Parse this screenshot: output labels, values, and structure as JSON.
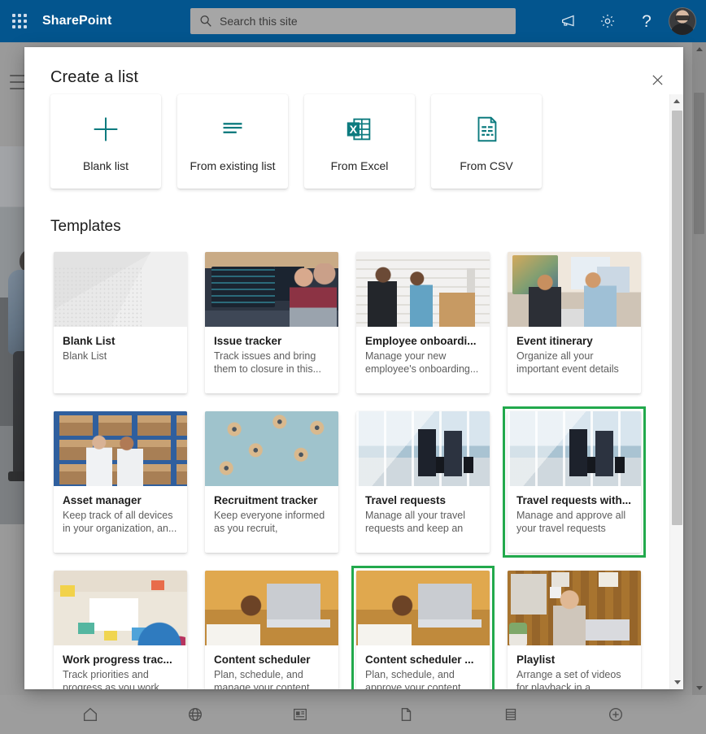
{
  "suite": {
    "waffle_label": "App launcher",
    "brand": "SharePoint",
    "search": {
      "placeholder": "Search this site",
      "value": ""
    },
    "actions": [
      {
        "name": "megaphone-icon",
        "label": "What's new"
      },
      {
        "name": "gear-icon",
        "label": "Settings"
      },
      {
        "name": "help-icon",
        "label": "?"
      }
    ],
    "avatar_label": "Account manager"
  },
  "dialog": {
    "title": "Create a list",
    "close_label": "Close",
    "sources": [
      {
        "label": "Blank list",
        "icon": "plus-icon"
      },
      {
        "label": "From existing list",
        "icon": "list-lines-icon"
      },
      {
        "label": "From Excel",
        "icon": "excel-icon"
      },
      {
        "label": "From CSV",
        "icon": "csv-icon"
      }
    ],
    "templates_heading": "Templates",
    "templates": [
      {
        "name": "Blank List",
        "desc": "Blank List",
        "art": "t-blank",
        "selected": false
      },
      {
        "name": "Issue tracker",
        "desc": "Track issues and bring them to closure in this...",
        "art": "t-issue",
        "selected": false
      },
      {
        "name": "Employee onboardi...",
        "desc": "Manage your new employee's onboarding...",
        "art": "t-onboard",
        "selected": false
      },
      {
        "name": "Event itinerary",
        "desc": "Organize all your important event details i...",
        "art": "t-event",
        "selected": false
      },
      {
        "name": "Asset manager",
        "desc": "Keep track of all devices in your organization, an...",
        "art": "t-asset",
        "selected": false
      },
      {
        "name": "Recruitment tracker",
        "desc": "Keep everyone informed as you recruit, interview,...",
        "art": "t-recruit",
        "selected": false
      },
      {
        "name": "Travel requests",
        "desc": "Manage all your travel requests and keep an ey...",
        "art": "t-travel",
        "selected": false
      },
      {
        "name": "Travel requests with...",
        "desc": "Manage and approve all your travel requests and...",
        "art": "t-travel",
        "selected": true
      },
      {
        "name": "Work progress trac...",
        "desc": "Track priorities and progress as you work...",
        "art": "t-work",
        "selected": false
      },
      {
        "name": "Content scheduler",
        "desc": "Plan, schedule, and manage your content...",
        "art": "t-content",
        "selected": false
      },
      {
        "name": "Content scheduler ...",
        "desc": "Plan, schedule, and approve your content...",
        "art": "t-content",
        "selected": true
      },
      {
        "name": "Playlist",
        "desc": "Arrange a set of videos for playback in a specific...",
        "art": "t-playlist",
        "selected": false
      }
    ]
  },
  "bottom_nav": [
    {
      "name": "home-icon",
      "label": "Home"
    },
    {
      "name": "globe-icon",
      "label": "Sites"
    },
    {
      "name": "news-icon",
      "label": "News"
    },
    {
      "name": "page-icon",
      "label": "Pages"
    },
    {
      "name": "list-icon",
      "label": "Lists"
    },
    {
      "name": "create-icon",
      "label": "Create"
    }
  ],
  "colors": {
    "header_blue": "#03558e",
    "accent_teal": "#0d7b7f",
    "selection_green": "#22a94c"
  }
}
